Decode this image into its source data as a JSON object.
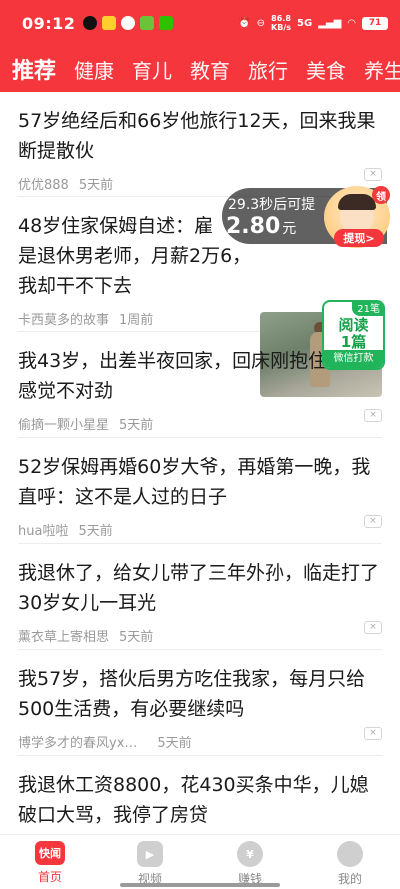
{
  "status_bar": {
    "time": "09:12",
    "net_speed_value": "86.8",
    "net_speed_unit": "KB/s",
    "signal": "5G",
    "battery": "71"
  },
  "tabs": [
    {
      "label": "推荐",
      "active": true
    },
    {
      "label": "健康"
    },
    {
      "label": "育儿"
    },
    {
      "label": "教育"
    },
    {
      "label": "旅行"
    },
    {
      "label": "美食"
    },
    {
      "label": "养生"
    }
  ],
  "feed": [
    {
      "title": "57岁绝经后和66岁他旅行12天，回来我果断提散伙",
      "author": "优优888",
      "time": "5天前"
    },
    {
      "title_1": "48岁住家保姆自述：雇",
      "title_2": "是退休男老师，月薪2万6，",
      "title_3": "我却干不下去",
      "author": "卡西莫多的故事",
      "time": "1周前"
    },
    {
      "title_1": "我43岁，出差半夜回家，回床刚抱住",
      "title_2": "感觉不对劲",
      "author": "偷摘一颗小星星",
      "time": "5天前"
    },
    {
      "title": "52岁保姆再婚60岁大爷，再婚第一晚，我直呼：这不是人过的日子",
      "author": "hua啦啦",
      "time": "5天前"
    },
    {
      "title": "我退休了，给女儿带了三年外孙，临走打了30岁女儿一耳光",
      "author": "薰衣草上寄相思",
      "time": "5天前"
    },
    {
      "title": "我57岁，搭伙后男方吃住我家，每月只给500生活费，有必要继续吗",
      "author": "博学多才的春风yx…",
      "time": "5天前"
    },
    {
      "title": "我退休工资8800，花430买条中华，儿媳破口大骂，我停了房贷",
      "author": "",
      "time": ""
    }
  ],
  "reward": {
    "countdown_text": "29.3秒后可提",
    "amount": "2.80",
    "unit": "元",
    "badge": "领",
    "button": "提现>"
  },
  "read_card": {
    "count": "21笔",
    "line1": "阅读",
    "line2": "1篇",
    "footer": "微信打款"
  },
  "bottom_nav": [
    {
      "label": "首页",
      "icon_text": "快闻",
      "active": true
    },
    {
      "label": "视频"
    },
    {
      "label": "赚钱",
      "icon_text": "¥"
    },
    {
      "label": "我的"
    }
  ],
  "close_symbol": "×",
  "colors": {
    "brand": "#f5373d",
    "green": "#22b45a"
  }
}
